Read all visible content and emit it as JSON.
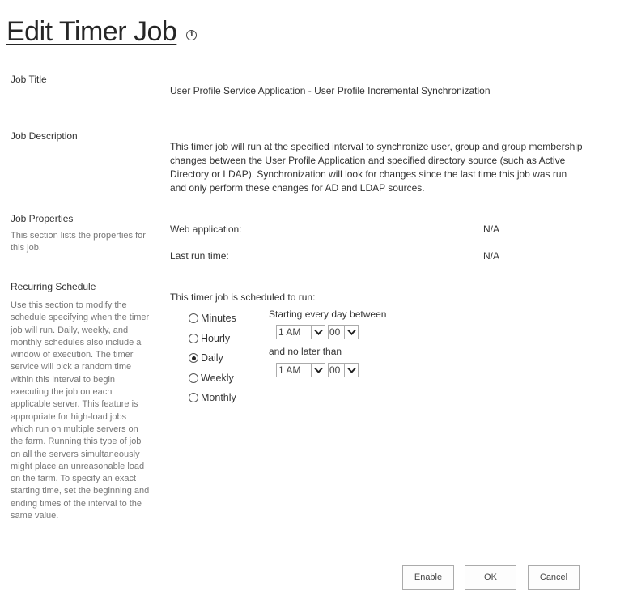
{
  "page": {
    "title": "Edit Timer Job",
    "info_icon": "info-icon"
  },
  "job_title": {
    "label": "Job Title",
    "value": "User Profile Service Application - User Profile Incremental Synchronization"
  },
  "job_description": {
    "label": "Job Description",
    "value": "This timer job will run at the specified interval to synchronize user, group and group membership changes between the User Profile Application and specified directory source (such as Active Directory or LDAP). Synchronization will look for changes since the last time this job was run and only perform these changes for AD and LDAP sources."
  },
  "job_properties": {
    "label": "Job Properties",
    "description": "This section lists the properties for this job.",
    "items": [
      {
        "label": "Web application:",
        "value": "N/A"
      },
      {
        "label": "Last run time:",
        "value": "N/A"
      }
    ]
  },
  "recurring_schedule": {
    "label": "Recurring Schedule",
    "description": "Use this section to modify the schedule specifying when the timer job will run. Daily, weekly, and monthly schedules also include a window of execution. The timer service will pick a random time within this interval to begin executing the job on each applicable server. This feature is appropriate for high-load jobs which run on multiple servers on the farm. Running this type of job on all the servers simultaneously might place an unreasonable load on the farm. To specify an exact starting time, set the beginning and ending times of the interval to the same value.",
    "intro": "This timer job is scheduled to run:",
    "options": [
      {
        "label": "Minutes",
        "checked": false
      },
      {
        "label": "Hourly",
        "checked": false
      },
      {
        "label": "Daily",
        "checked": true
      },
      {
        "label": "Weekly",
        "checked": false
      },
      {
        "label": "Monthly",
        "checked": false
      }
    ],
    "start_label": "Starting every day between",
    "start_hour": "1 AM",
    "start_minute": "00",
    "end_label": "and no later than",
    "end_hour": "1 AM",
    "end_minute": "00"
  },
  "buttons": {
    "enable": "Enable",
    "ok": "OK",
    "cancel": "Cancel"
  }
}
